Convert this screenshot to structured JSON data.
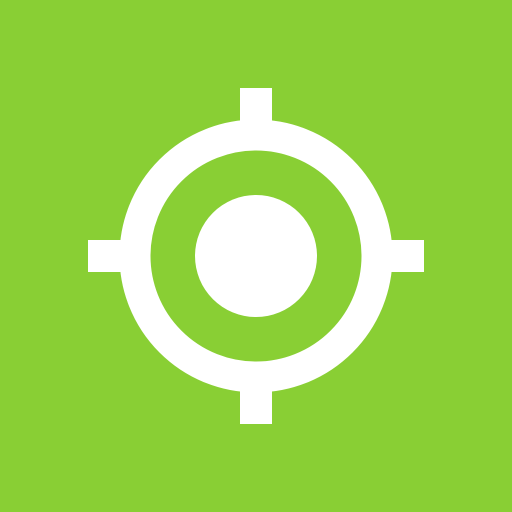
{
  "app_icon": {
    "icon": "my-location-icon",
    "colors": {
      "background": "#89cf34",
      "foreground": "#ffffff"
    }
  }
}
